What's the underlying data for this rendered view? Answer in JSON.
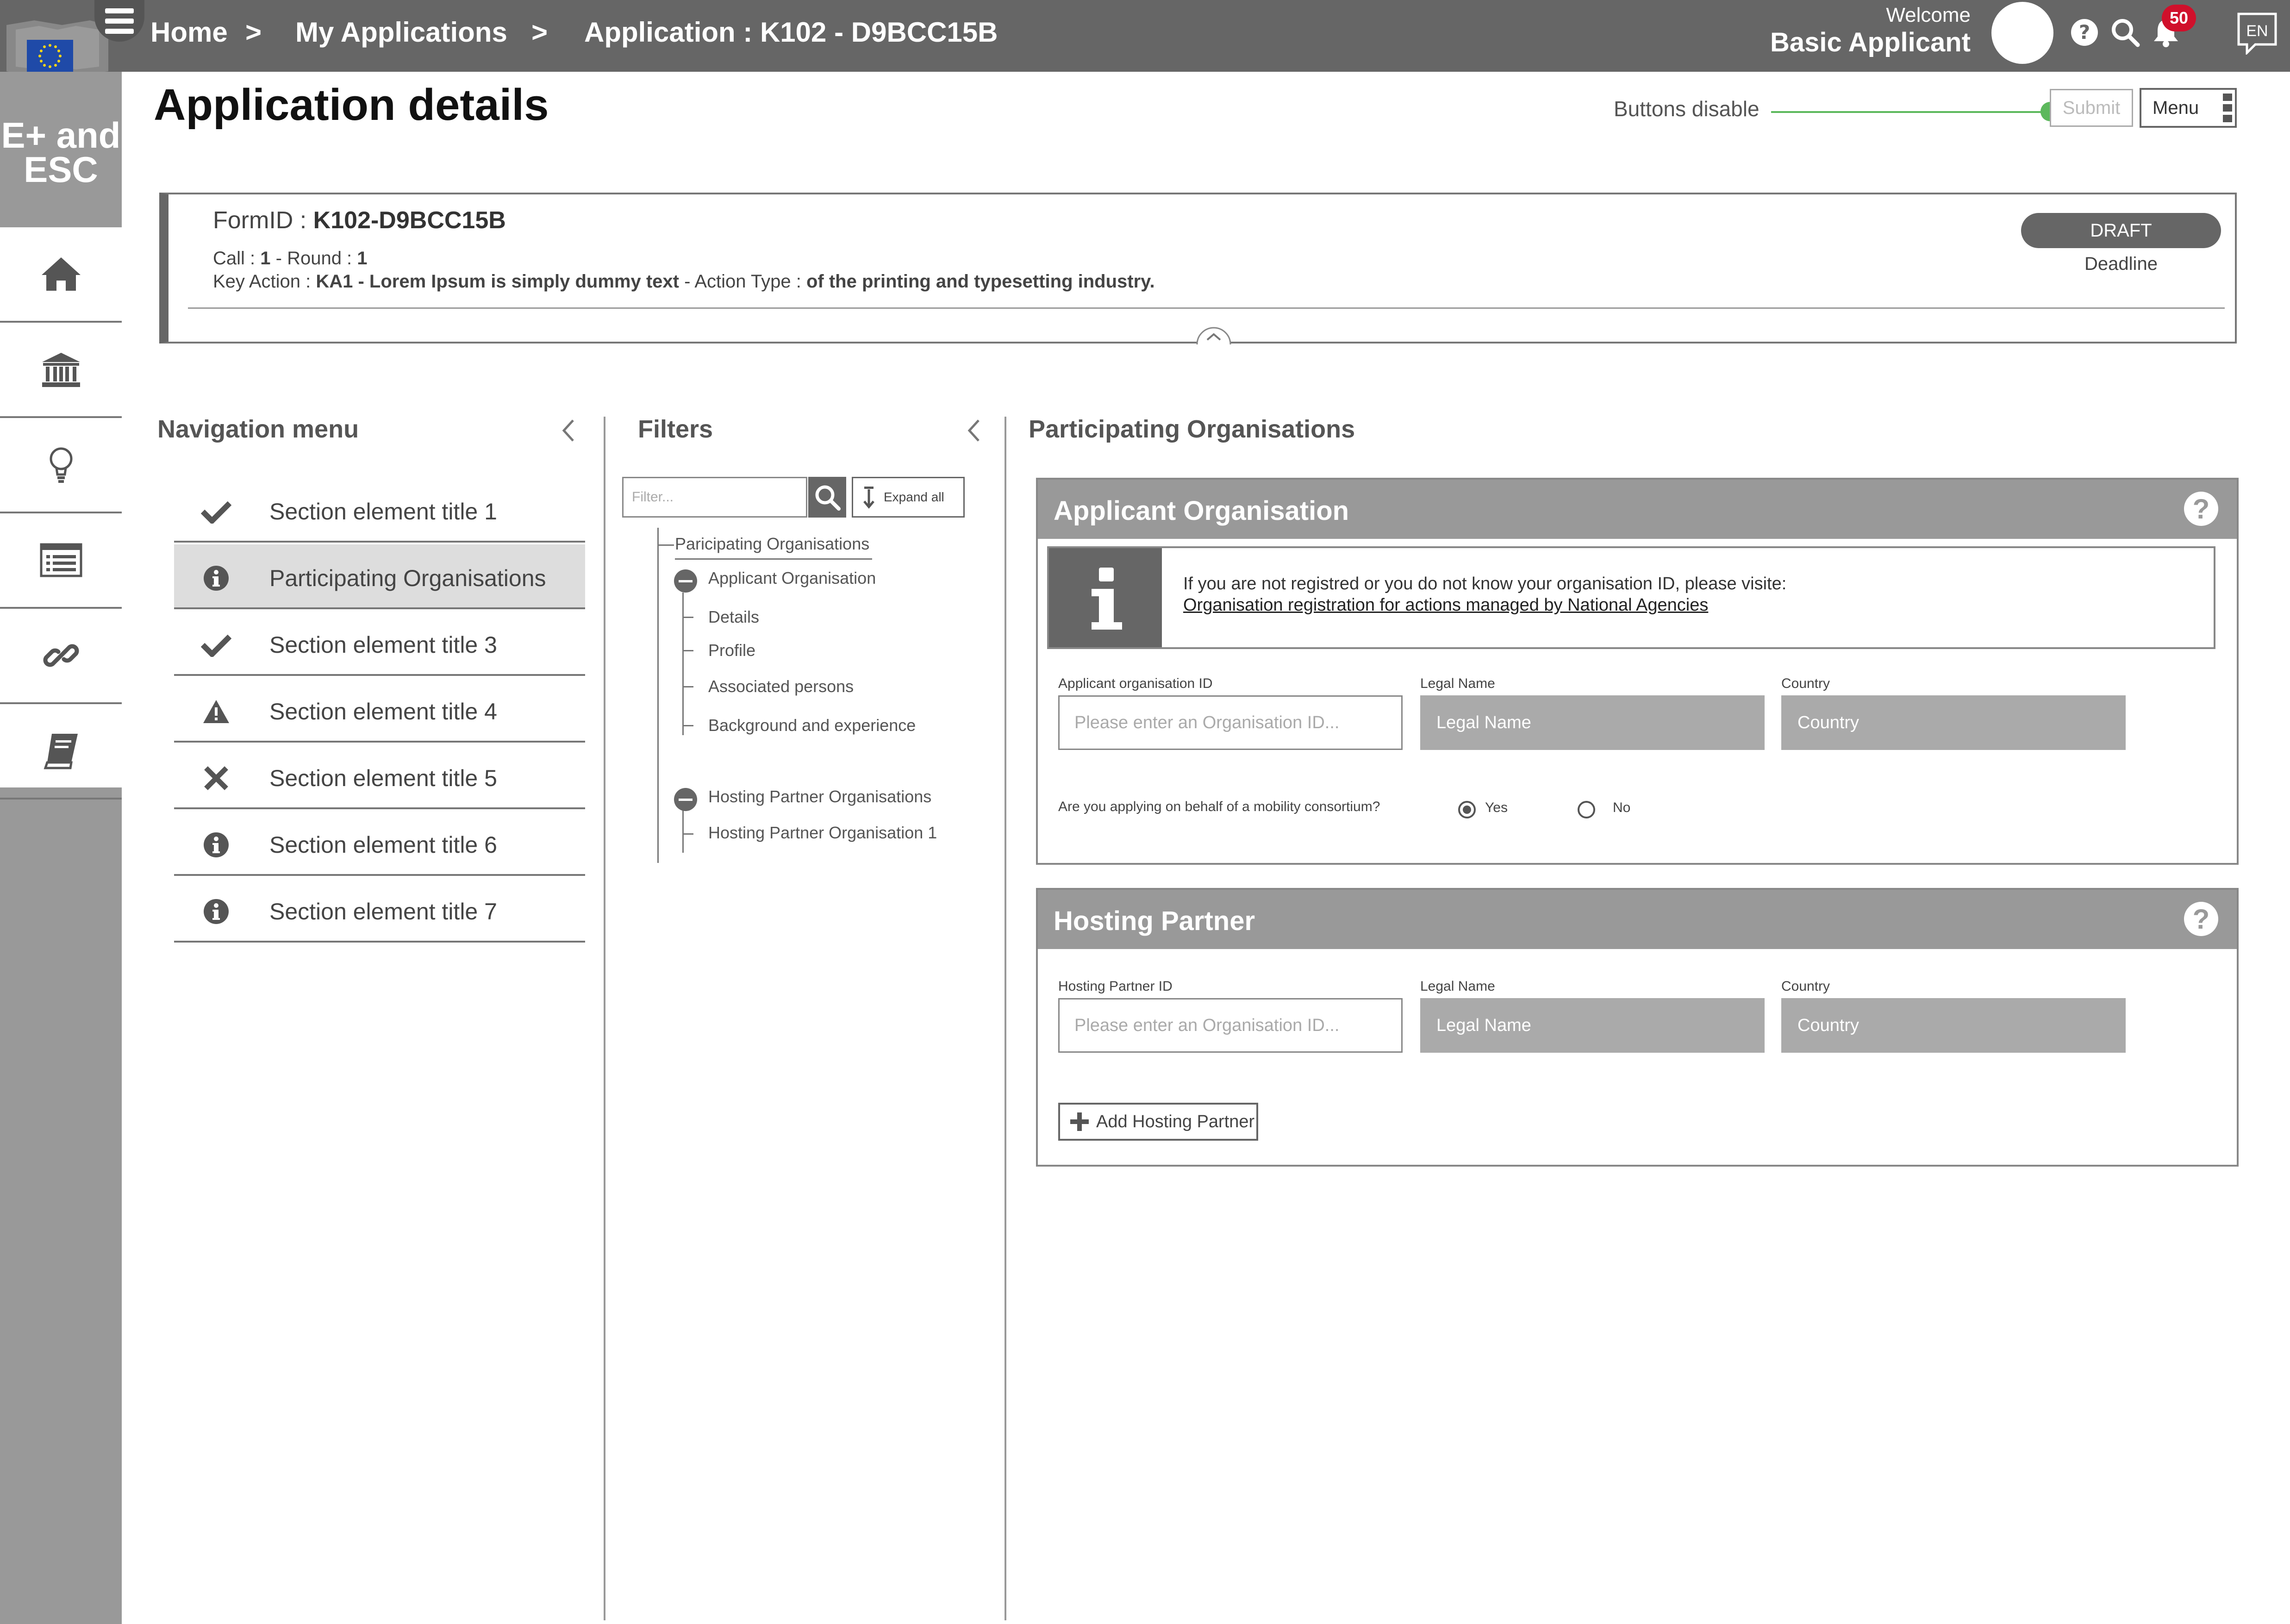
{
  "header": {
    "breadcrumb": [
      "Home",
      ">",
      "My Applications",
      ">",
      "Application : K102 - D9BCC15B"
    ],
    "welcome": "Welcome",
    "username": "Basic Applicant",
    "notification_count": "50",
    "language": "EN"
  },
  "sidebar": {
    "app_name": "E+ and ESC",
    "items": [
      {
        "icon": "home-icon"
      },
      {
        "icon": "institution-icon"
      },
      {
        "icon": "lightbulb-icon"
      },
      {
        "icon": "list-card-icon"
      },
      {
        "icon": "link-icon"
      },
      {
        "icon": "book-icon"
      }
    ]
  },
  "page": {
    "title": "Application details",
    "buttons_disable_label": "Buttons disable",
    "submit_label": "Submit",
    "menu_label": "Menu"
  },
  "form": {
    "form_id_label": "FormID :",
    "form_id_value": "K102-D9BCC15B",
    "call_label": "Call :",
    "call_value": "1",
    "round_label": "- Round :",
    "round_value": "1",
    "key_action_label": "Key Action :",
    "key_action_value": "KA1 - Lorem Ipsum is simply dummy text",
    "action_type_label": "- Action Type :",
    "action_type_value": "of the printing and typesetting industry.",
    "status": "DRAFT",
    "deadline_label": "Deadline"
  },
  "navigation": {
    "title": "Navigation menu",
    "items": [
      {
        "label": "Section element title 1",
        "status": "check"
      },
      {
        "label": "Participating Organisations",
        "status": "info"
      },
      {
        "label": "Section element title 3",
        "status": "check"
      },
      {
        "label": "Section element title 4",
        "status": "warning"
      },
      {
        "label": "Section element title 5",
        "status": "error"
      },
      {
        "label": "Section element title 6",
        "status": "info"
      },
      {
        "label": "Section element title 7",
        "status": "info"
      }
    ]
  },
  "filters": {
    "title": "Filters",
    "placeholder": "Filter...",
    "expand_all": "Expand all",
    "tree": {
      "root": "Paricipating Organisations",
      "applicant": "Applicant Organisation",
      "applicant_children": [
        "Details",
        "Profile",
        "Associated persons",
        "Background and experience"
      ],
      "hosting": "Hosting Partner Organisations",
      "hosting_children": [
        "Hosting Partner Organisation 1"
      ]
    }
  },
  "participating": {
    "title": "Participating Organisations",
    "applicant_panel": {
      "title": "Applicant Organisation",
      "info_text": "If you are not registred or you do not  know your organisation ID, please visite:",
      "info_link": "Organisation registration for actions managed by National Agencies",
      "id_label": "Applicant organisation ID",
      "id_placeholder": "Please enter an Organisation ID...",
      "legal_label": "Legal Name",
      "legal_value": "Legal Name",
      "country_label": "Country",
      "country_value": "Country",
      "mobility_question": "Are you applying on behalf of a mobility consortium?",
      "yes_label": "Yes",
      "no_label": "No",
      "selected": "Yes"
    },
    "hosting_panel": {
      "title": "Hosting Partner",
      "id_label": "Hosting Partner ID",
      "id_placeholder": "Please enter an Organisation ID...",
      "legal_label": "Legal Name",
      "legal_value": "Legal Name",
      "country_label": "Country",
      "country_value": "Country",
      "add_label": "Add Hosting Partner"
    }
  }
}
